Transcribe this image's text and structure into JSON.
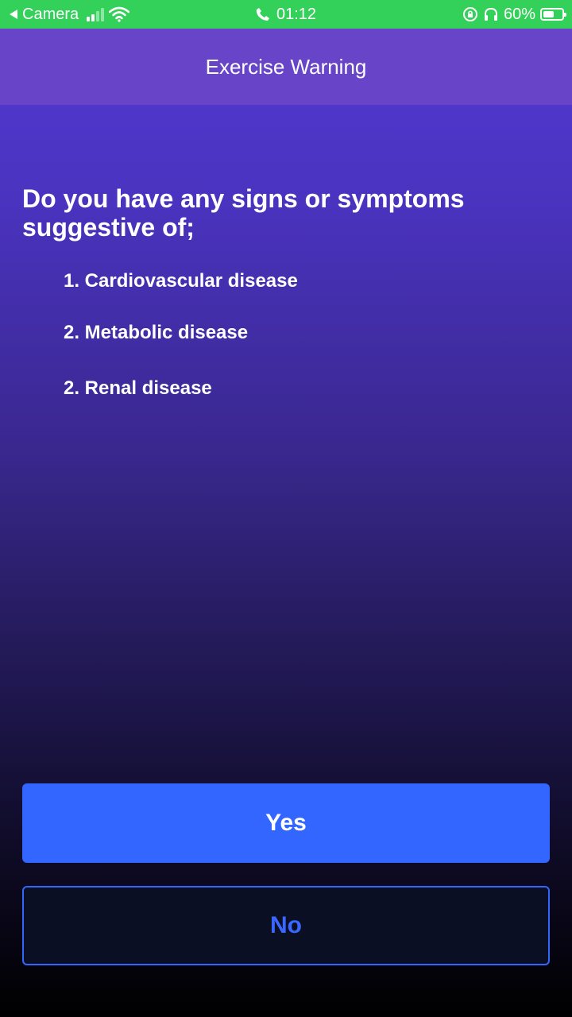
{
  "status_bar": {
    "back_app": "Camera",
    "time": "01:12",
    "battery_percent": "60%",
    "battery_level": 0.6,
    "background_color": "#33d05a"
  },
  "header": {
    "title": "Exercise Warning",
    "background_color": "#6845c8"
  },
  "question": "Do you have any signs or symptoms suggestive of;",
  "conditions": [
    "1. Cardiovascular disease",
    "2. Metabolic disease",
    "2. Renal disease"
  ],
  "buttons": {
    "yes_label": "Yes",
    "no_label": "No",
    "accent_color": "#3366ff"
  }
}
